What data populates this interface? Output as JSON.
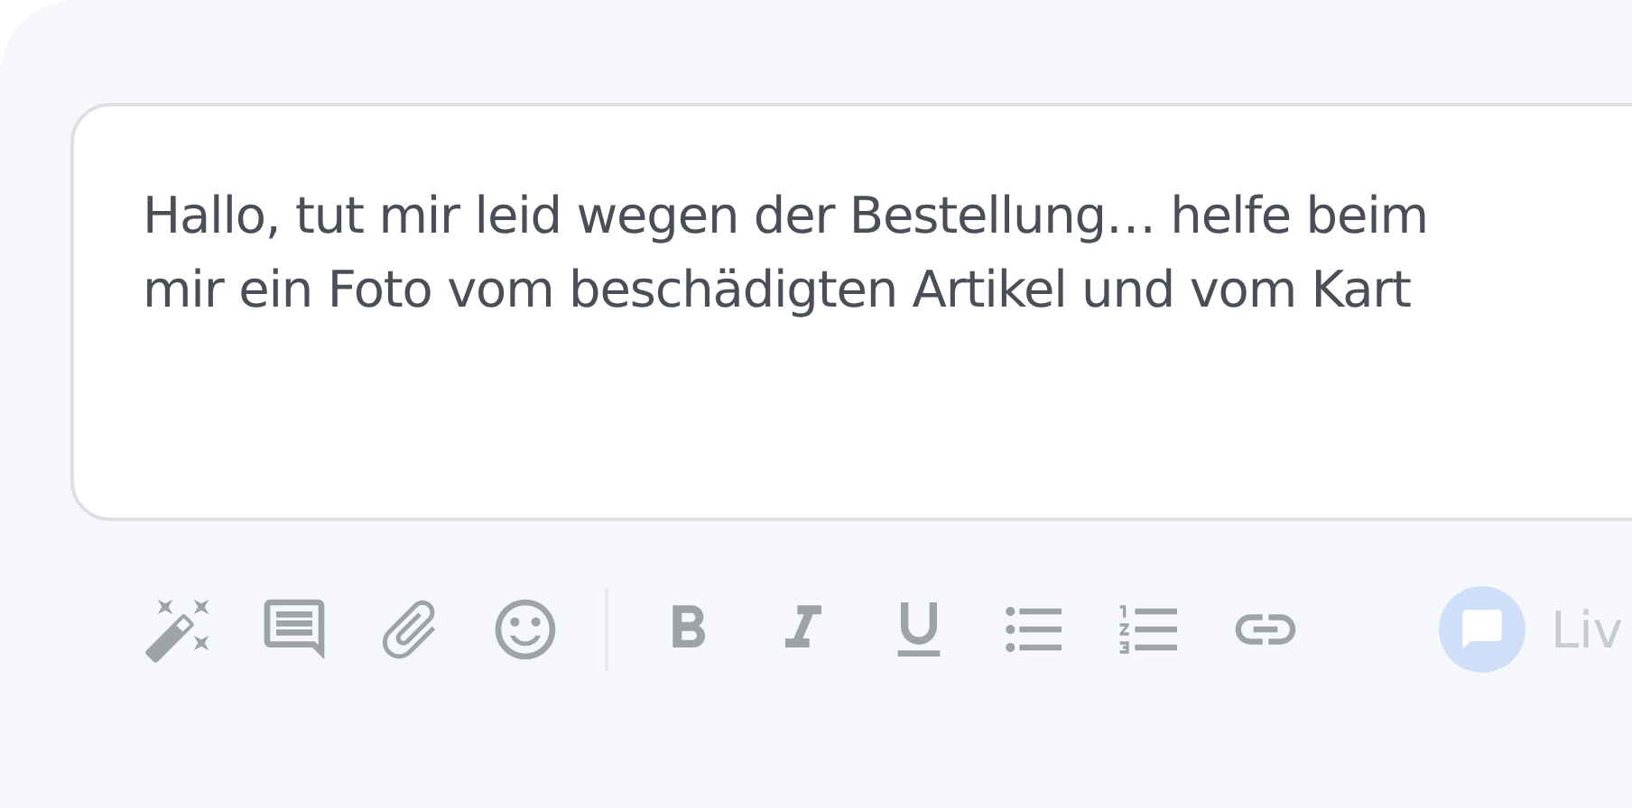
{
  "composer": {
    "message_lines": [
      "Hallo, tut mir leid wegen der Bestellung… helfe beim",
      "mir ein Foto vom beschädigten Artikel und vom Kart"
    ]
  },
  "toolbar": {
    "groups": [
      [
        {
          "kind": "magic"
        },
        {
          "kind": "snippet"
        },
        {
          "kind": "attach"
        },
        {
          "kind": "emoji"
        }
      ],
      [
        {
          "kind": "bold"
        },
        {
          "kind": "italic"
        },
        {
          "kind": "underline"
        },
        {
          "kind": "bullets"
        },
        {
          "kind": "numbered"
        },
        {
          "kind": "link"
        }
      ]
    ],
    "live_button": {
      "label": "Liv"
    }
  }
}
